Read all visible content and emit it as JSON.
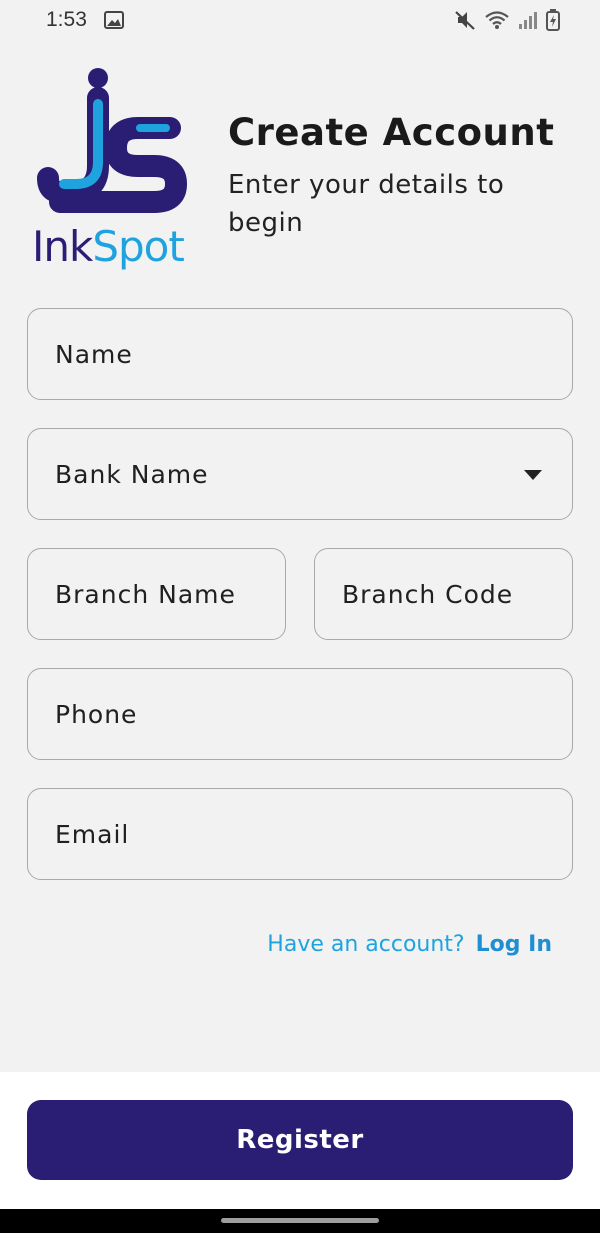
{
  "status_bar": {
    "time": "1:53",
    "icons": [
      "gallery-icon",
      "mute-icon",
      "wifi-icon",
      "signal-icon",
      "battery-icon"
    ]
  },
  "logo": {
    "text": "InkSpot",
    "colors": {
      "primary": "#2a1d74",
      "secondary": "#1fa3df"
    }
  },
  "header": {
    "title": "Create Account",
    "subtitle": "Enter your details to begin"
  },
  "form": {
    "name_placeholder": "Name",
    "bank_name_placeholder": "Bank Name",
    "branch_name_placeholder": "Branch Name",
    "branch_code_placeholder": "Branch Code",
    "phone_placeholder": "Phone",
    "email_placeholder": "Email"
  },
  "login_prompt": {
    "text": "Have an account?",
    "link": "Log In"
  },
  "register_button": "Register",
  "colors": {
    "background": "#f2f2f2",
    "button": "#2a1d74",
    "link": "#1fa3df",
    "border": "#a9a9a9"
  }
}
